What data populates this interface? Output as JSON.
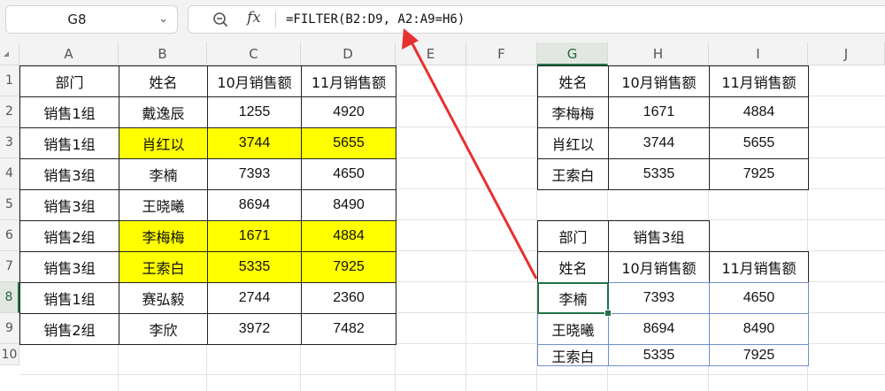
{
  "namebox": {
    "ref": "G8"
  },
  "formula": {
    "text": "=FILTER(B2:D9, A2:A9=H6)"
  },
  "columns": [
    "A",
    "B",
    "C",
    "D",
    "E",
    "F",
    "G",
    "H",
    "I",
    "J"
  ],
  "rows": [
    "1",
    "2",
    "3",
    "4",
    "5",
    "6",
    "7",
    "8",
    "9",
    "10"
  ],
  "selected_col": "G",
  "selected_row": "8",
  "source_table": {
    "headers": [
      "部门",
      "姓名",
      "10月销售额",
      "11月销售额"
    ],
    "rows": [
      [
        "销售1组",
        "戴逸辰",
        "1255",
        "4920"
      ],
      [
        "销售1组",
        "肖红以",
        "3744",
        "5655"
      ],
      [
        "销售3组",
        "李楠",
        "7393",
        "4650"
      ],
      [
        "销售3组",
        "王晓曦",
        "8694",
        "8490"
      ],
      [
        "销售2组",
        "李梅梅",
        "1671",
        "4884"
      ],
      [
        "销售3组",
        "王索白",
        "5335",
        "7925"
      ],
      [
        "销售1组",
        "赛弘毅",
        "2744",
        "2360"
      ],
      [
        "销售2组",
        "李欣",
        "3972",
        "7482"
      ]
    ],
    "highlight_color": "#ffff00"
  },
  "lookup_table": {
    "headers": [
      "姓名",
      "10月销售额",
      "11月销售额"
    ],
    "rows": [
      [
        "李梅梅",
        "1671",
        "4884"
      ],
      [
        "肖红以",
        "3744",
        "5655"
      ],
      [
        "王索白",
        "5335",
        "7925"
      ]
    ]
  },
  "filter_block": {
    "criteria_label": "部门",
    "criteria_value": "销售3组",
    "headers": [
      "姓名",
      "10月销售额",
      "11月销售额"
    ],
    "rows": [
      [
        "李楠",
        "7393",
        "4650"
      ],
      [
        "王晓曦",
        "8694",
        "8490"
      ],
      [
        "王索白",
        "5335",
        "7925"
      ]
    ]
  },
  "colors": {
    "accent": "#217346",
    "arrow": "#e8312f",
    "spill_border": "#6f8fd1"
  }
}
